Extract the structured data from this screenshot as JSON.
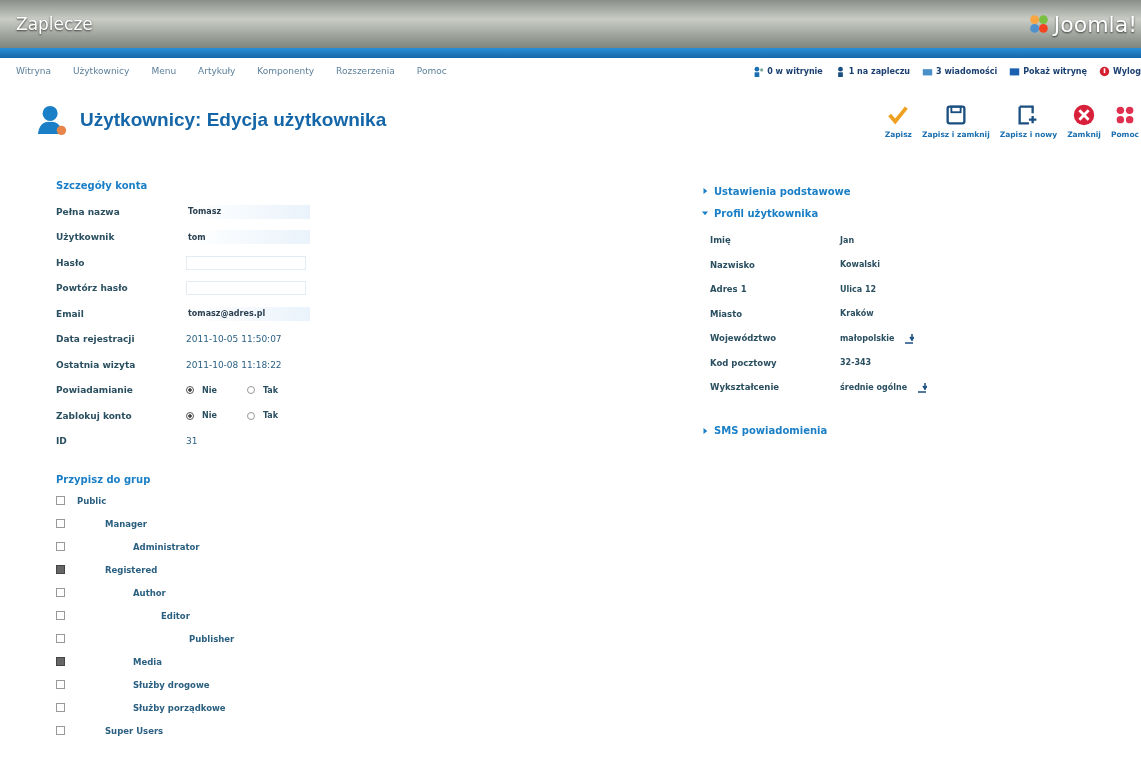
{
  "header": {
    "title": "Zaplecze",
    "logo": "Joomla!"
  },
  "menu": [
    "Witryna",
    "Użytkownicy",
    "Menu",
    "Artykuły",
    "Komponenty",
    "Rozszerzenia",
    "Pomoc"
  ],
  "status": [
    {
      "kind": "users",
      "label": "0 w witrynie"
    },
    {
      "kind": "admin",
      "label": "1 na zapleczu"
    },
    {
      "kind": "mail",
      "label": "3 wiadomości"
    },
    {
      "kind": "site",
      "label": "Pokaż witrynę"
    },
    {
      "kind": "logout",
      "label": "Wylog"
    }
  ],
  "page_title": "Użytkownicy: Edycja użytkownika",
  "toolbar": [
    {
      "kind": "apply",
      "label": "Zapisz"
    },
    {
      "kind": "save",
      "label": "Zapisz i zamknij"
    },
    {
      "kind": "new",
      "label": "Zapisz i nowy"
    },
    {
      "kind": "cancel",
      "label": "Zamknij"
    },
    {
      "kind": "help",
      "label": "Pomoc"
    }
  ],
  "account": {
    "heading": "Szczegóły konta",
    "fields": [
      {
        "kind": "input",
        "label": "Pełna nazwa",
        "value": "Tomasz"
      },
      {
        "kind": "input",
        "label": "Użytkownik",
        "value": "tom"
      },
      {
        "kind": "password",
        "label": "Hasło"
      },
      {
        "kind": "password",
        "label": "Powtórz hasło"
      },
      {
        "kind": "input",
        "label": "Email",
        "value": "tomasz@adres.pl"
      },
      {
        "kind": "text",
        "label": "Data rejestracji",
        "value": "2011-10-05 11:50:07"
      },
      {
        "kind": "text",
        "label": "Ostatnia wizyta",
        "value": "2011-10-08 11:18:22"
      },
      {
        "kind": "radio",
        "label": "Powiadamianie",
        "options": [
          {
            "label": "Nie",
            "selected": true
          },
          {
            "label": "Tak",
            "selected": false
          }
        ]
      },
      {
        "kind": "radio",
        "label": "Zablokuj konto",
        "options": [
          {
            "label": "Nie",
            "selected": true
          },
          {
            "label": "Tak",
            "selected": false
          }
        ]
      },
      {
        "kind": "text",
        "label": "ID",
        "value": "31"
      }
    ]
  },
  "groups": {
    "heading": "Przypisz do grup",
    "items": [
      {
        "label": "Public",
        "checked": false,
        "children": [
          {
            "label": "Manager",
            "checked": false,
            "children": [
              {
                "label": "Administrator",
                "checked": false
              }
            ]
          },
          {
            "label": "Registered",
            "checked": true,
            "children": [
              {
                "label": "Author",
                "checked": false,
                "children": [
                  {
                    "label": "Editor",
                    "checked": false,
                    "children": [
                      {
                        "label": "Publisher",
                        "checked": false
                      }
                    ]
                  }
                ]
              },
              {
                "label": "Media",
                "checked": true
              },
              {
                "label": "Służby drogowe",
                "checked": false
              },
              {
                "label": "Służby porządkowe",
                "checked": false
              }
            ]
          },
          {
            "label": "Super Users",
            "checked": false
          }
        ]
      }
    ]
  },
  "panels": [
    {
      "title": "Ustawienia podstawowe",
      "expanded": false
    },
    {
      "title": "Profil użytkownika",
      "expanded": true,
      "fields": [
        {
          "kind": "text",
          "label": "Imię",
          "value": "Jan"
        },
        {
          "kind": "text",
          "label": "Nazwisko",
          "value": "Kowalski"
        },
        {
          "kind": "text",
          "label": "Adres 1",
          "value": "Ulica 12"
        },
        {
          "kind": "text",
          "label": "Miasto",
          "value": "Kraków"
        },
        {
          "kind": "select",
          "label": "Województwo",
          "value": "małopolskie"
        },
        {
          "kind": "text",
          "label": "Kod pocztowy",
          "value": "32-343"
        },
        {
          "kind": "select",
          "label": "Wykształcenie",
          "value": "średnie ogólne"
        }
      ]
    },
    {
      "title": "SMS powiadomienia",
      "expanded": false
    }
  ]
}
